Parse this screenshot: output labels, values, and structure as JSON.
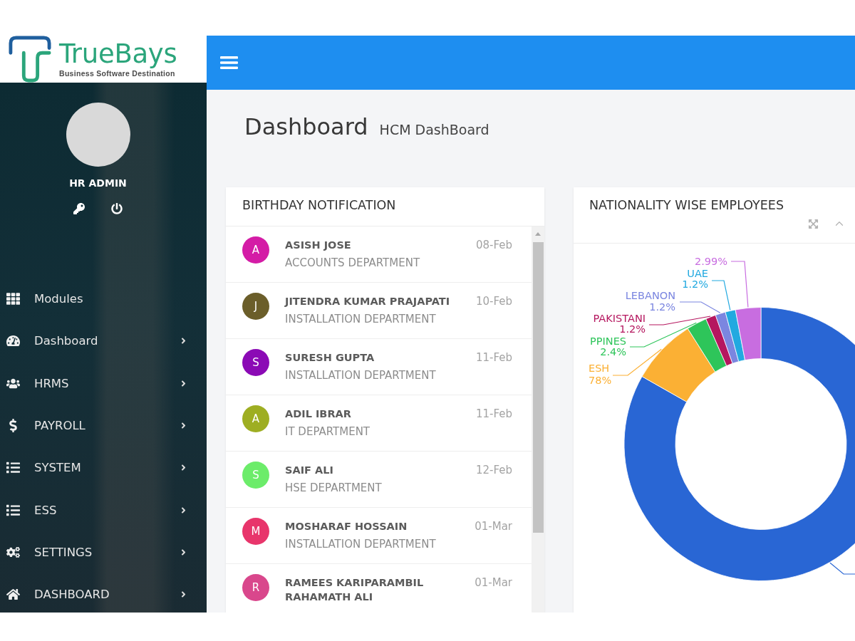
{
  "logo": {
    "name": "TrueBays",
    "tagline": "Business Software Destination"
  },
  "user": {
    "name": "HR ADMIN"
  },
  "sidebar": {
    "items": [
      {
        "label": "Modules",
        "expandable": false
      },
      {
        "label": "Dashboard",
        "expandable": true
      },
      {
        "label": "HRMS",
        "expandable": true
      },
      {
        "label": "PAYROLL",
        "expandable": true
      },
      {
        "label": "SYSTEM",
        "expandable": true
      },
      {
        "label": "ESS",
        "expandable": true
      },
      {
        "label": "SETTINGS",
        "expandable": true
      },
      {
        "label": "DASHBOARD",
        "expandable": true
      }
    ]
  },
  "page": {
    "title": "Dashboard",
    "subtitle": "HCM DashBoard"
  },
  "birthdays": {
    "title": "BIRTHDAY NOTIFICATION",
    "items": [
      {
        "initial": "A",
        "color": "#d41ca6",
        "name": "ASISH JOSE",
        "department": "ACCOUNTS DEPARTMENT",
        "date": "08-Feb"
      },
      {
        "initial": "J",
        "color": "#6b5e2a",
        "name": "JITENDRA KUMAR PRAJAPATI",
        "department": "INSTALLATION DEPARTMENT",
        "date": "10-Feb"
      },
      {
        "initial": "S",
        "color": "#8b0ab5",
        "name": "SURESH GUPTA",
        "department": "INSTALLATION DEPARTMENT",
        "date": "11-Feb"
      },
      {
        "initial": "A",
        "color": "#9eae22",
        "name": "ADIL IBRAR",
        "department": "IT DEPARTMENT",
        "date": "11-Feb"
      },
      {
        "initial": "S",
        "color": "#6cec6a",
        "name": "SAIF ALI",
        "department": "HSE DEPARTMENT",
        "date": "12-Feb"
      },
      {
        "initial": "M",
        "color": "#e8356b",
        "name": "MOSHARAF HOSSAIN",
        "department": "INSTALLATION DEPARTMENT",
        "date": "01-Mar"
      },
      {
        "initial": "R",
        "color": "#d9478c",
        "name": "RAMEES KARIPARAMBIL RAHAMATH ALI",
        "date": "01-Mar"
      }
    ]
  },
  "nationality": {
    "title": "NATIONALITY WISE EMPLOYEES",
    "chart_data": {
      "type": "donut",
      "categories": [
        null,
        "ESH",
        "PPINES",
        "PAKISTANI",
        "LEBANON",
        "UAE",
        null
      ],
      "values": [
        83.23,
        7.78,
        2.4,
        1.2,
        1.2,
        1.2,
        2.99
      ],
      "colors": [
        "#2966d4",
        "#fbb034",
        "#2ec55a",
        "#b5175f",
        "#7b86e0",
        "#22a9e0",
        "#c86de0"
      ],
      "value_labels": [
        null,
        null,
        "2.4%",
        "1.2%",
        "1.2%",
        "1.2%",
        "2.99%"
      ],
      "annotations": [
        {
          "text": "78%"
        }
      ]
    }
  }
}
